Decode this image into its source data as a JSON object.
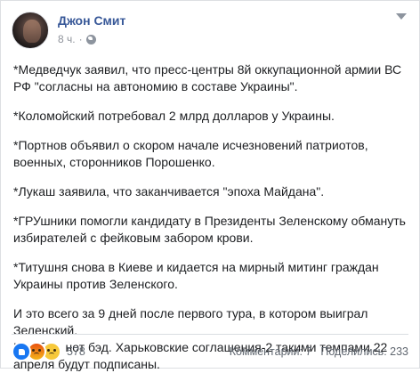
{
  "post": {
    "author": "Джон Смит",
    "time": "8 ч.",
    "separator": "·",
    "paragraphs": [
      "*Медведчук заявил, что пресс-центры 8й оккупационной армии ВС РФ \"согласны на автономию в составе Украины\".",
      "*Коломойский потребовал 2 млрд долларов у Украины.",
      "*Портнов объявил о скором начале исчезновений патриотов, военных, сторонников Порошенко.",
      "*Лукаш заявила, что заканчивается \"эпоха Майдана\".",
      "*ГРУшники помогли кандидату в Президенты Зеленскому обмануть избирателей с фейковым забором крови.",
      "*Титушня снова в Киеве и кидается на мирный митинг граждан Украины против Зеленского.",
      "И это всего за 9 дней после первого тура, в котором выиграл Зеленский.",
      "Нот бэд, нот бэд. Харьковские соглашения-2 такими темпами 22 апреля будут подписаны."
    ]
  },
  "footer": {
    "reaction_count": "578",
    "comments": "Комментарии: 7",
    "shares": "Поделились: 233",
    "reaction_icons": [
      "like-icon",
      "angry-icon",
      "sad-icon"
    ],
    "accent": "#385898"
  }
}
